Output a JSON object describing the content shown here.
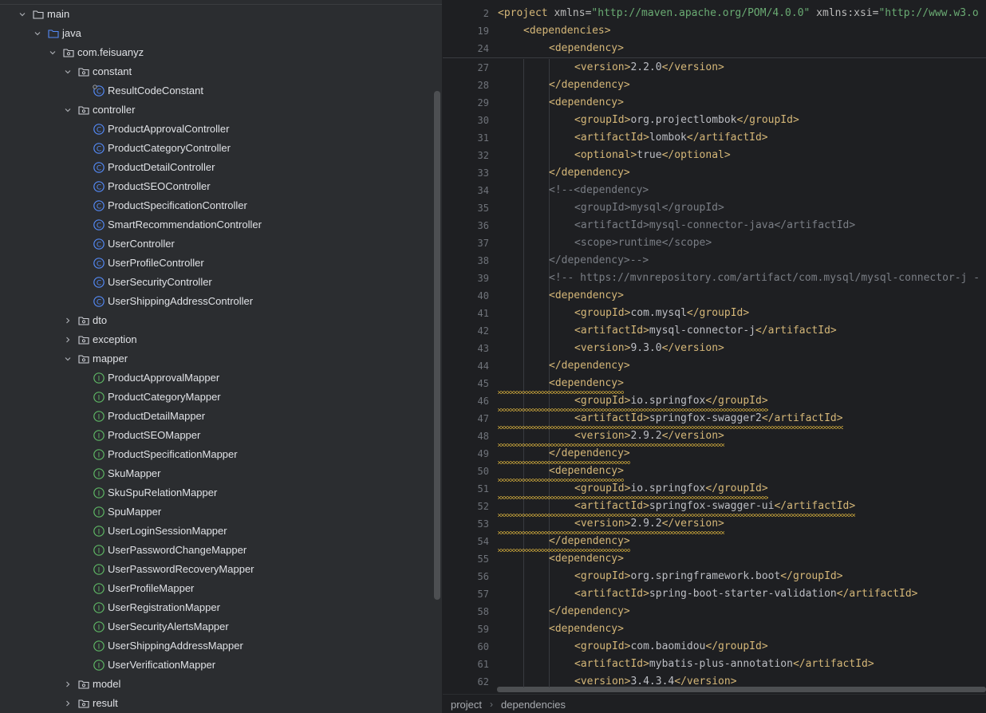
{
  "project_tree": {
    "items": [
      {
        "label": "main",
        "depth": 0,
        "kind": "folder-src",
        "state": "expanded"
      },
      {
        "label": "java",
        "depth": 1,
        "kind": "folder-java",
        "state": "expanded"
      },
      {
        "label": "com.feisuanyz",
        "depth": 2,
        "kind": "package",
        "state": "expanded"
      },
      {
        "label": "constant",
        "depth": 3,
        "kind": "package",
        "state": "expanded"
      },
      {
        "label": "ResultCodeConstant",
        "depth": 4,
        "kind": "class-static",
        "state": "none"
      },
      {
        "label": "controller",
        "depth": 3,
        "kind": "package",
        "state": "expanded"
      },
      {
        "label": "ProductApprovalController",
        "depth": 4,
        "kind": "class",
        "state": "none"
      },
      {
        "label": "ProductCategoryController",
        "depth": 4,
        "kind": "class",
        "state": "none"
      },
      {
        "label": "ProductDetailController",
        "depth": 4,
        "kind": "class",
        "state": "none"
      },
      {
        "label": "ProductSEOController",
        "depth": 4,
        "kind": "class",
        "state": "none"
      },
      {
        "label": "ProductSpecificationController",
        "depth": 4,
        "kind": "class",
        "state": "none"
      },
      {
        "label": "SmartRecommendationController",
        "depth": 4,
        "kind": "class",
        "state": "none"
      },
      {
        "label": "UserController",
        "depth": 4,
        "kind": "class",
        "state": "none"
      },
      {
        "label": "UserProfileController",
        "depth": 4,
        "kind": "class",
        "state": "none"
      },
      {
        "label": "UserSecurityController",
        "depth": 4,
        "kind": "class",
        "state": "none"
      },
      {
        "label": "UserShippingAddressController",
        "depth": 4,
        "kind": "class",
        "state": "none"
      },
      {
        "label": "dto",
        "depth": 3,
        "kind": "package",
        "state": "collapsed"
      },
      {
        "label": "exception",
        "depth": 3,
        "kind": "package",
        "state": "collapsed"
      },
      {
        "label": "mapper",
        "depth": 3,
        "kind": "package",
        "state": "expanded"
      },
      {
        "label": "ProductApprovalMapper",
        "depth": 4,
        "kind": "interface",
        "state": "none"
      },
      {
        "label": "ProductCategoryMapper",
        "depth": 4,
        "kind": "interface",
        "state": "none"
      },
      {
        "label": "ProductDetailMapper",
        "depth": 4,
        "kind": "interface",
        "state": "none"
      },
      {
        "label": "ProductSEOMapper",
        "depth": 4,
        "kind": "interface",
        "state": "none"
      },
      {
        "label": "ProductSpecificationMapper",
        "depth": 4,
        "kind": "interface",
        "state": "none"
      },
      {
        "label": "SkuMapper",
        "depth": 4,
        "kind": "interface",
        "state": "none"
      },
      {
        "label": "SkuSpuRelationMapper",
        "depth": 4,
        "kind": "interface",
        "state": "none"
      },
      {
        "label": "SpuMapper",
        "depth": 4,
        "kind": "interface",
        "state": "none"
      },
      {
        "label": "UserLoginSessionMapper",
        "depth": 4,
        "kind": "interface",
        "state": "none"
      },
      {
        "label": "UserPasswordChangeMapper",
        "depth": 4,
        "kind": "interface",
        "state": "none"
      },
      {
        "label": "UserPasswordRecoveryMapper",
        "depth": 4,
        "kind": "interface",
        "state": "none"
      },
      {
        "label": "UserProfileMapper",
        "depth": 4,
        "kind": "interface",
        "state": "none"
      },
      {
        "label": "UserRegistrationMapper",
        "depth": 4,
        "kind": "interface",
        "state": "none"
      },
      {
        "label": "UserSecurityAlertsMapper",
        "depth": 4,
        "kind": "interface",
        "state": "none"
      },
      {
        "label": "UserShippingAddressMapper",
        "depth": 4,
        "kind": "interface",
        "state": "none"
      },
      {
        "label": "UserVerificationMapper",
        "depth": 4,
        "kind": "interface",
        "state": "none"
      },
      {
        "label": "model",
        "depth": 3,
        "kind": "package",
        "state": "collapsed"
      },
      {
        "label": "result",
        "depth": 3,
        "kind": "package",
        "state": "collapsed"
      }
    ]
  },
  "editor": {
    "sticky_lines": [
      {
        "num": "2",
        "indent": 0,
        "tokens": [
          [
            "tag",
            "<project "
          ],
          [
            "attr",
            "xmlns="
          ],
          [
            "val",
            "\"http://maven.apache.org/POM/4.0.0\""
          ],
          [
            "attr",
            " xmlns:xsi="
          ],
          [
            "val",
            "\"http://www.w3.o"
          ]
        ]
      },
      {
        "num": "19",
        "indent": 1,
        "tokens": [
          [
            "tag",
            "<dependencies>"
          ]
        ]
      },
      {
        "num": "24",
        "indent": 2,
        "tokens": [
          [
            "tag",
            "<dependency>"
          ]
        ]
      }
    ],
    "lines": [
      {
        "num": "27",
        "indent": 3,
        "tokens": [
          [
            "tag",
            "<version>"
          ],
          [
            "txt",
            "2.2.0"
          ],
          [
            "tag",
            "</version>"
          ]
        ]
      },
      {
        "num": "28",
        "indent": 2,
        "tokens": [
          [
            "tag",
            "</dependency>"
          ]
        ]
      },
      {
        "num": "29",
        "indent": 2,
        "tokens": [
          [
            "tag",
            "<dependency>"
          ]
        ]
      },
      {
        "num": "30",
        "indent": 3,
        "tokens": [
          [
            "tag",
            "<groupId>"
          ],
          [
            "txt",
            "org.projectlombok"
          ],
          [
            "tag",
            "</groupId>"
          ]
        ]
      },
      {
        "num": "31",
        "indent": 3,
        "tokens": [
          [
            "tag",
            "<artifactId>"
          ],
          [
            "txt",
            "lombok"
          ],
          [
            "tag",
            "</artifactId>"
          ]
        ]
      },
      {
        "num": "32",
        "indent": 3,
        "tokens": [
          [
            "tag",
            "<optional>"
          ],
          [
            "txt",
            "true"
          ],
          [
            "tag",
            "</optional>"
          ]
        ]
      },
      {
        "num": "33",
        "indent": 2,
        "tokens": [
          [
            "tag",
            "</dependency>"
          ]
        ]
      },
      {
        "num": "34",
        "indent": 2,
        "tokens": [
          [
            "cmt",
            "<!--<dependency>"
          ]
        ]
      },
      {
        "num": "35",
        "indent": 3,
        "tokens": [
          [
            "cmt",
            "<groupId>mysql</groupId>"
          ]
        ]
      },
      {
        "num": "36",
        "indent": 3,
        "tokens": [
          [
            "cmt",
            "<artifactId>mysql-connector-java</artifactId>"
          ]
        ]
      },
      {
        "num": "37",
        "indent": 3,
        "tokens": [
          [
            "cmt",
            "<scope>runtime</scope>"
          ]
        ]
      },
      {
        "num": "38",
        "indent": 2,
        "tokens": [
          [
            "cmt",
            "</dependency>-->"
          ]
        ]
      },
      {
        "num": "39",
        "indent": 2,
        "tokens": [
          [
            "cmt",
            "<!-- https://mvnrepository.com/artifact/com.mysql/mysql-connector-j -"
          ]
        ]
      },
      {
        "num": "40",
        "indent": 2,
        "tokens": [
          [
            "tag",
            "<dependency>"
          ]
        ]
      },
      {
        "num": "41",
        "indent": 3,
        "tokens": [
          [
            "tag",
            "<groupId>"
          ],
          [
            "txt",
            "com.mysql"
          ],
          [
            "tag",
            "</groupId>"
          ]
        ]
      },
      {
        "num": "42",
        "indent": 3,
        "tokens": [
          [
            "tag",
            "<artifactId>"
          ],
          [
            "txt",
            "mysql-connector-j"
          ],
          [
            "tag",
            "</artifactId>"
          ]
        ]
      },
      {
        "num": "43",
        "indent": 3,
        "tokens": [
          [
            "tag",
            "<version>"
          ],
          [
            "txt",
            "9.3.0"
          ],
          [
            "tag",
            "</version>"
          ]
        ]
      },
      {
        "num": "44",
        "indent": 2,
        "tokens": [
          [
            "tag",
            "</dependency>"
          ]
        ]
      },
      {
        "num": "45",
        "indent": 2,
        "warn": true,
        "tokens": [
          [
            "tag",
            "<dependency>"
          ]
        ]
      },
      {
        "num": "46",
        "indent": 3,
        "warn": true,
        "tokens": [
          [
            "tag",
            "<groupId>"
          ],
          [
            "txt",
            "io.springfox"
          ],
          [
            "tag",
            "</groupId>"
          ]
        ]
      },
      {
        "num": "47",
        "indent": 3,
        "warn": true,
        "tokens": [
          [
            "tag",
            "<artifactId>"
          ],
          [
            "txt",
            "springfox-swagger2"
          ],
          [
            "tag",
            "</artifactId>"
          ]
        ]
      },
      {
        "num": "48",
        "indent": 3,
        "warn": true,
        "tokens": [
          [
            "tag",
            "<version>"
          ],
          [
            "txt",
            "2.9.2"
          ],
          [
            "tag",
            "</version>"
          ]
        ]
      },
      {
        "num": "49",
        "indent": 2,
        "warn": true,
        "tokens": [
          [
            "tag",
            "</dependency>"
          ]
        ]
      },
      {
        "num": "50",
        "indent": 2,
        "warn": true,
        "tokens": [
          [
            "tag",
            "<dependency>"
          ]
        ]
      },
      {
        "num": "51",
        "indent": 3,
        "warn": true,
        "tokens": [
          [
            "tag",
            "<groupId>"
          ],
          [
            "txt",
            "io.springfox"
          ],
          [
            "tag",
            "</groupId>"
          ]
        ]
      },
      {
        "num": "52",
        "indent": 3,
        "warn": true,
        "tokens": [
          [
            "tag",
            "<artifactId>"
          ],
          [
            "txt",
            "springfox-swagger-ui"
          ],
          [
            "tag",
            "</artifactId>"
          ]
        ]
      },
      {
        "num": "53",
        "indent": 3,
        "warn": true,
        "tokens": [
          [
            "tag",
            "<version>"
          ],
          [
            "txt",
            "2.9.2"
          ],
          [
            "tag",
            "</version>"
          ]
        ]
      },
      {
        "num": "54",
        "indent": 2,
        "warn": true,
        "tokens": [
          [
            "tag",
            "</dependency>"
          ]
        ]
      },
      {
        "num": "55",
        "indent": 2,
        "tokens": [
          [
            "tag",
            "<dependency>"
          ]
        ]
      },
      {
        "num": "56",
        "indent": 3,
        "tokens": [
          [
            "tag",
            "<groupId>"
          ],
          [
            "txt",
            "org.springframework.boot"
          ],
          [
            "tag",
            "</groupId>"
          ]
        ]
      },
      {
        "num": "57",
        "indent": 3,
        "tokens": [
          [
            "tag",
            "<artifactId>"
          ],
          [
            "txt",
            "spring-boot-starter-validation"
          ],
          [
            "tag",
            "</artifactId>"
          ]
        ]
      },
      {
        "num": "58",
        "indent": 2,
        "tokens": [
          [
            "tag",
            "</dependency>"
          ]
        ]
      },
      {
        "num": "59",
        "indent": 2,
        "tokens": [
          [
            "tag",
            "<dependency>"
          ]
        ]
      },
      {
        "num": "60",
        "indent": 3,
        "tokens": [
          [
            "tag",
            "<groupId>"
          ],
          [
            "txt",
            "com.baomidou"
          ],
          [
            "tag",
            "</groupId>"
          ]
        ]
      },
      {
        "num": "61",
        "indent": 3,
        "tokens": [
          [
            "tag",
            "<artifactId>"
          ],
          [
            "txt",
            "mybatis-plus-annotation"
          ],
          [
            "tag",
            "</artifactId>"
          ]
        ]
      },
      {
        "num": "62",
        "indent": 3,
        "tokens": [
          [
            "tag",
            "<version>"
          ],
          [
            "txt",
            "3.4.3.4"
          ],
          [
            "tag",
            "</version>"
          ]
        ]
      }
    ]
  },
  "breadcrumb": {
    "items": [
      "project",
      "dependencies"
    ]
  },
  "colors": {
    "tag": "#d5b778",
    "text": "#bcbec4",
    "value": "#6aab73",
    "comment": "#7a7e85",
    "class_icon": "#548af7",
    "interface_icon": "#5fb865",
    "warning_underline": "#c9a43a"
  }
}
